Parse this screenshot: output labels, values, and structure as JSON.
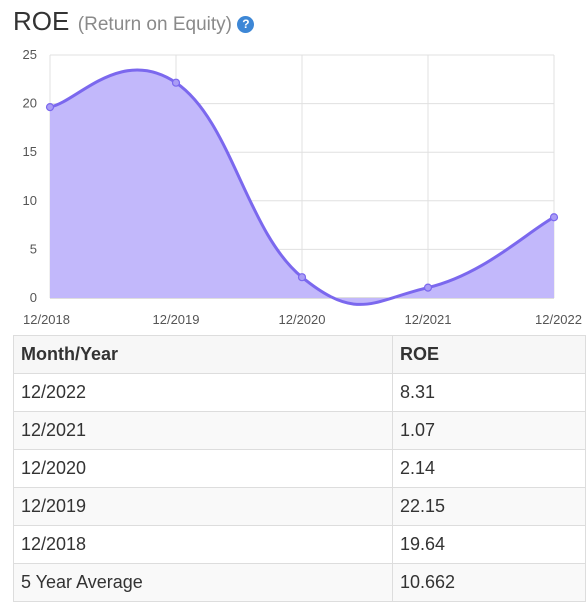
{
  "header": {
    "title": "ROE",
    "subtitle": "(Return on Equity)",
    "help_icon_glyph": "?"
  },
  "chart_data": {
    "type": "area",
    "x": [
      "12/2018",
      "12/2019",
      "12/2020",
      "12/2021",
      "12/2022"
    ],
    "values": [
      19.64,
      22.15,
      2.14,
      1.07,
      8.31
    ],
    "ylim": [
      0,
      25
    ],
    "yticks": [
      0,
      5,
      10,
      15,
      20,
      25
    ],
    "grid": true,
    "line_color": "#7b68ee",
    "fill_color": "#c2b8fb",
    "title": "",
    "xlabel": "",
    "ylabel": ""
  },
  "table": {
    "headers": [
      "Month/Year",
      "ROE"
    ],
    "rows": [
      [
        "12/2022",
        "8.31"
      ],
      [
        "12/2021",
        "1.07"
      ],
      [
        "12/2020",
        "2.14"
      ],
      [
        "12/2019",
        "22.15"
      ],
      [
        "12/2018",
        "19.64"
      ],
      [
        "5 Year Average",
        "10.662"
      ]
    ]
  }
}
